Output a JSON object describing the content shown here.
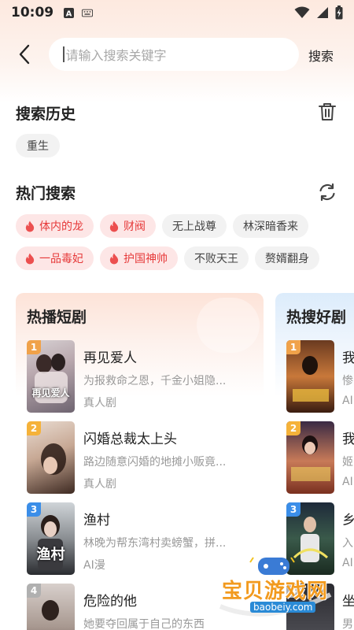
{
  "status_bar": {
    "time": "10:09",
    "icons": [
      "notification-a-icon",
      "keyboard-icon",
      "wifi-icon",
      "signal-icon",
      "battery-charging-icon"
    ]
  },
  "search": {
    "placeholder": "请输入搜索关键字",
    "button_label": "搜索"
  },
  "history": {
    "title": "搜索历史",
    "items": [
      "重生"
    ]
  },
  "hot_search": {
    "title": "热门搜索",
    "row1": [
      {
        "label": "体内的龙",
        "hot": true
      },
      {
        "label": "财阀",
        "hot": true
      },
      {
        "label": "无上战尊",
        "hot": false
      },
      {
        "label": "林深暗香来",
        "hot": false
      }
    ],
    "row2": [
      {
        "label": "一品毒妃",
        "hot": true
      },
      {
        "label": "护国神帅",
        "hot": true
      },
      {
        "label": "不败天王",
        "hot": false
      },
      {
        "label": "赘婿翻身",
        "hot": false
      }
    ]
  },
  "card_hot_play": {
    "title": "热播短剧",
    "items": [
      {
        "rank": "1",
        "title": "再见爱人",
        "desc": "为报救命之恩，千金小姐隐...",
        "tag": "真人剧",
        "poster_text": "再见爱人"
      },
      {
        "rank": "2",
        "title": "闪婚总裁太上头",
        "desc": "路边随意闪婚的地摊小贩竟...",
        "tag": "真人剧",
        "poster_text": ""
      },
      {
        "rank": "3",
        "title": "渔村",
        "desc": "林晚为帮东湾村卖螃蟹，拼...",
        "tag": "AI漫",
        "poster_text": "渔村"
      },
      {
        "rank": "4",
        "title": "危险的他",
        "desc": "她要夺回属于自己的东西",
        "tag": "",
        "poster_text": ""
      }
    ]
  },
  "card_hot_search": {
    "title": "热搜好剧",
    "items": [
      {
        "rank": "1",
        "title": "我",
        "desc": "惨",
        "tag": "AI"
      },
      {
        "rank": "2",
        "title": "我",
        "desc": "姬",
        "tag": "AI"
      },
      {
        "rank": "3",
        "title": "乡",
        "desc": "入",
        "tag": "AI"
      },
      {
        "rank": "4",
        "title": "坐",
        "desc": "男",
        "tag": ""
      }
    ]
  },
  "watermark": {
    "text": "宝贝游戏网",
    "url": "baobeiy.com"
  },
  "colors": {
    "rank1": "#f0a24a",
    "rank2": "#f5b23a",
    "rank3": "#3b8ee8",
    "rank4": "#b0b0b0",
    "hot_text": "#e63a3a",
    "hot_bg": "#fde6e6"
  }
}
